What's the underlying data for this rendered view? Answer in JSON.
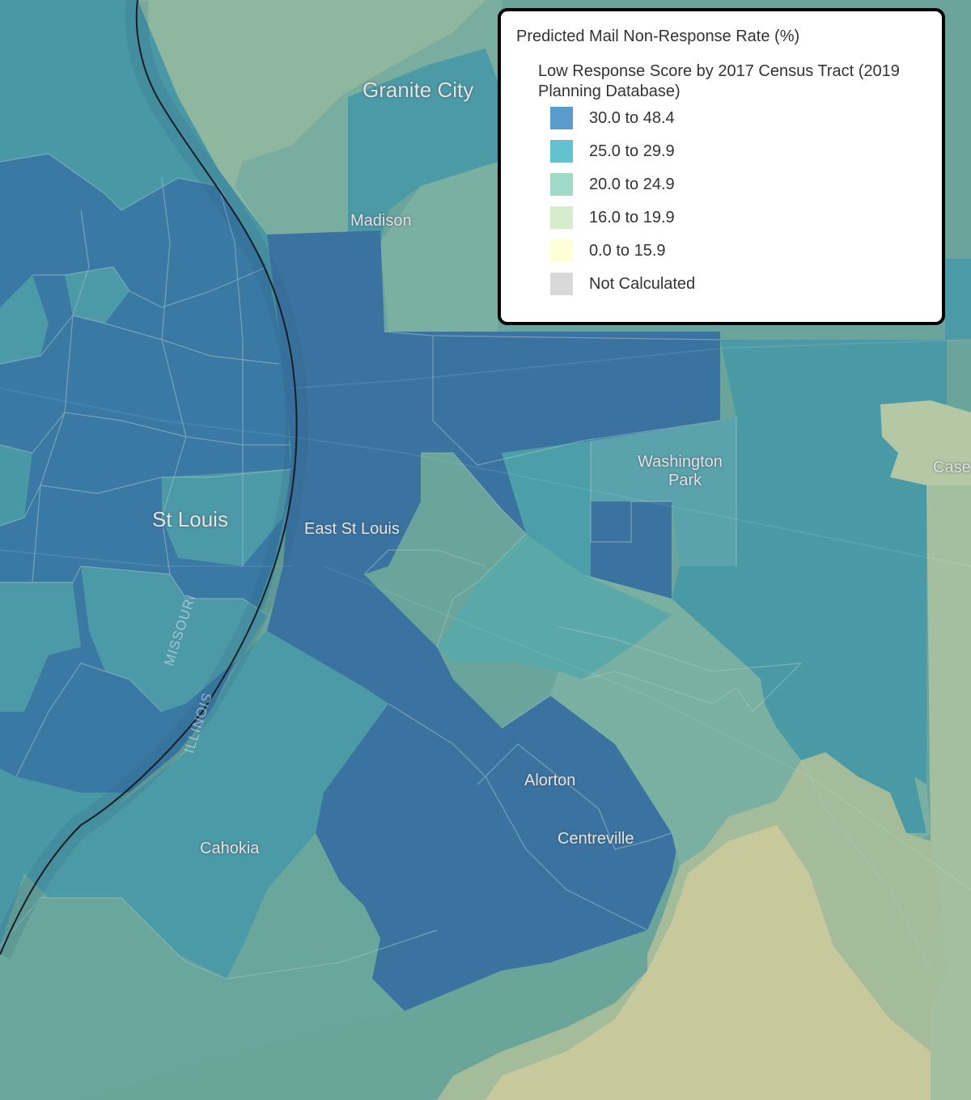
{
  "map": {
    "labels": {
      "granite_city": "Granite City",
      "madison": "Madison",
      "st_louis": "St Louis",
      "east_st_louis": "East St Louis",
      "washington_park_1": "Washington",
      "washington_park_2": "Park",
      "cahokia": "Cahokia",
      "alorton": "Alorton",
      "centreville": "Centreville",
      "caseyville_partial": "Case",
      "missouri": "MISSOURI",
      "illinois": "ILLINOIS"
    }
  },
  "legend": {
    "title": "Predicted Mail Non-Response Rate (%)",
    "subtitle": "Low Response Score by 2017 Census Tract (2019 Planning Database)",
    "classes": [
      {
        "label": "30.0 to 48.4",
        "color": "#5a9bcb"
      },
      {
        "label": "25.0 to 29.9",
        "color": "#64c1cf"
      },
      {
        "label": "20.0 to 24.9",
        "color": "#9fdac8"
      },
      {
        "label": "16.0 to 19.9",
        "color": "#d7eccd"
      },
      {
        "label": "0.0 to 15.9",
        "color": "#ffffd6"
      },
      {
        "label": "Not Calculated",
        "color": "#d9d9d9"
      }
    ]
  }
}
